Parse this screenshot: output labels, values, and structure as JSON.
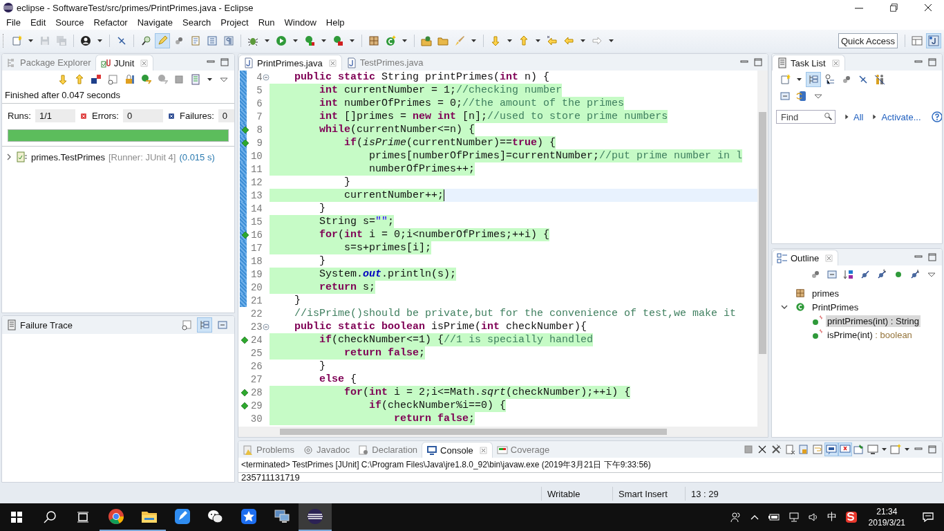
{
  "window": {
    "title": "eclipse - SoftwareTest/src/primes/PrintPrimes.java - Eclipse"
  },
  "menu": [
    "File",
    "Edit",
    "Source",
    "Refactor",
    "Navigate",
    "Search",
    "Project",
    "Run",
    "Window",
    "Help"
  ],
  "toolbar": {
    "highlight_pressed": true,
    "quick_access": {
      "placeholder": "Quick Access"
    }
  },
  "left_panel": {
    "tabs": [
      {
        "label": "Package Explorer",
        "selected": false
      },
      {
        "label": "JUnit",
        "selected": true
      }
    ],
    "status": "Finished after 0.047 seconds",
    "counters": [
      {
        "label": "Runs:",
        "value": "1/1"
      },
      {
        "label": "Errors:",
        "value": "0"
      },
      {
        "label": "Failures:",
        "value": "0"
      }
    ],
    "progress": {
      "level": 1
    },
    "tree": [
      {
        "label": "primes.TestPrimes",
        "detail": "[Runner: JUnit 4]",
        "time": "(0.015 s)",
        "expanded": false
      }
    ]
  },
  "failure_trace": {
    "title": "Failure Trace",
    "compare_pressed": true
  },
  "editor": {
    "tabs": [
      {
        "label": "PrintPrimes.java",
        "selected": true
      },
      {
        "label": "TestPrimes.java",
        "selected": false
      }
    ],
    "lines": [
      {
        "number": "4",
        "covered": false,
        "branch": false,
        "range": true,
        "fold": true,
        "current": false,
        "segments": [
          {
            "kind": "keyword",
            "text": "    public static"
          },
          {
            "kind": "plain",
            "text": " String printPrimes("
          },
          {
            "kind": "keyword",
            "text": "int"
          },
          {
            "kind": "plain",
            "text": " n) {"
          }
        ]
      },
      {
        "number": "5",
        "covered": true,
        "branch": false,
        "range": true,
        "fold": false,
        "current": false,
        "segments": [
          {
            "kind": "keyword",
            "text": "        int"
          },
          {
            "kind": "plain",
            "text": " currentNumber = 1;"
          },
          {
            "kind": "comment",
            "text": "//checking number"
          }
        ]
      },
      {
        "number": "6",
        "covered": true,
        "branch": false,
        "range": true,
        "fold": false,
        "current": false,
        "segments": [
          {
            "kind": "keyword",
            "text": "        int"
          },
          {
            "kind": "plain",
            "text": " numberOfPrimes = 0;"
          },
          {
            "kind": "comment",
            "text": "//the amount of the primes"
          }
        ]
      },
      {
        "number": "7",
        "covered": true,
        "branch": false,
        "range": true,
        "fold": false,
        "current": false,
        "segments": [
          {
            "kind": "keyword",
            "text": "        int"
          },
          {
            "kind": "plain",
            "text": " []primes = "
          },
          {
            "kind": "keyword",
            "text": "new int"
          },
          {
            "kind": "plain",
            "text": " [n];"
          },
          {
            "kind": "comment",
            "text": "//used to store prime numbers"
          }
        ]
      },
      {
        "number": "8",
        "covered": true,
        "branch": true,
        "range": true,
        "fold": false,
        "current": false,
        "segments": [
          {
            "kind": "keyword",
            "text": "        while"
          },
          {
            "kind": "plain",
            "text": "(currentNumber<=n) {"
          }
        ]
      },
      {
        "number": "9",
        "covered": true,
        "branch": true,
        "range": true,
        "fold": false,
        "current": false,
        "segments": [
          {
            "kind": "keyword",
            "text": "            if"
          },
          {
            "kind": "plain",
            "text": "("
          },
          {
            "kind": "method",
            "text": "isPrime"
          },
          {
            "kind": "plain",
            "text": "(currentNumber)=="
          },
          {
            "kind": "keyword",
            "text": "true"
          },
          {
            "kind": "plain",
            "text": ") {"
          }
        ]
      },
      {
        "number": "10",
        "covered": true,
        "branch": false,
        "range": true,
        "fold": false,
        "current": false,
        "segments": [
          {
            "kind": "plain",
            "text": "                primes[numberOfPrimes]=currentNumber;"
          },
          {
            "kind": "comment",
            "text": "//put prime number in l"
          }
        ]
      },
      {
        "number": "11",
        "covered": true,
        "branch": false,
        "range": true,
        "fold": false,
        "current": false,
        "segments": [
          {
            "kind": "plain",
            "text": "                numberOfPrimes++;"
          }
        ]
      },
      {
        "number": "12",
        "covered": false,
        "branch": false,
        "range": true,
        "fold": false,
        "current": false,
        "segments": [
          {
            "kind": "plain",
            "text": "            }"
          }
        ]
      },
      {
        "number": "13",
        "covered": true,
        "branch": false,
        "range": true,
        "fold": false,
        "current": true,
        "segments": [
          {
            "kind": "plain",
            "text": "            currentNumber++;"
          }
        ]
      },
      {
        "number": "14",
        "covered": false,
        "branch": false,
        "range": true,
        "fold": false,
        "current": false,
        "segments": [
          {
            "kind": "plain",
            "text": "        }"
          }
        ]
      },
      {
        "number": "15",
        "covered": true,
        "branch": false,
        "range": true,
        "fold": false,
        "current": false,
        "segments": [
          {
            "kind": "plain",
            "text": "        String s="
          },
          {
            "kind": "string",
            "text": "\"\""
          },
          {
            "kind": "plain",
            "text": ";"
          }
        ]
      },
      {
        "number": "16",
        "covered": true,
        "branch": true,
        "range": true,
        "fold": false,
        "current": false,
        "segments": [
          {
            "kind": "keyword",
            "text": "        for"
          },
          {
            "kind": "plain",
            "text": "("
          },
          {
            "kind": "keyword",
            "text": "int"
          },
          {
            "kind": "plain",
            "text": " i = 0;i<numberOfPrimes;++i) {"
          }
        ]
      },
      {
        "number": "17",
        "covered": true,
        "branch": false,
        "range": true,
        "fold": false,
        "current": false,
        "segments": [
          {
            "kind": "plain",
            "text": "            s=s+primes[i];"
          }
        ]
      },
      {
        "number": "18",
        "covered": false,
        "branch": false,
        "range": true,
        "fold": false,
        "current": false,
        "segments": [
          {
            "kind": "plain",
            "text": "        }"
          }
        ]
      },
      {
        "number": "19",
        "covered": true,
        "branch": false,
        "range": true,
        "fold": false,
        "current": false,
        "segments": [
          {
            "kind": "plain",
            "text": "        System."
          },
          {
            "kind": "field",
            "text": "out"
          },
          {
            "kind": "plain",
            "text": ".println(s);"
          }
        ]
      },
      {
        "number": "20",
        "covered": true,
        "branch": false,
        "range": true,
        "fold": false,
        "current": false,
        "segments": [
          {
            "kind": "keyword",
            "text": "        return"
          },
          {
            "kind": "plain",
            "text": " s;"
          }
        ]
      },
      {
        "number": "21",
        "covered": false,
        "branch": false,
        "range": true,
        "fold": false,
        "current": false,
        "segments": [
          {
            "kind": "plain",
            "text": "    }"
          }
        ]
      },
      {
        "number": "22",
        "covered": false,
        "branch": false,
        "range": false,
        "fold": false,
        "current": false,
        "segments": [
          {
            "kind": "comment",
            "text": "    //isPrime()should be private,but for the convenience of test,we make it"
          }
        ]
      },
      {
        "number": "23",
        "covered": false,
        "branch": false,
        "range": false,
        "fold": true,
        "current": false,
        "segments": [
          {
            "kind": "keyword",
            "text": "    public static boolean"
          },
          {
            "kind": "plain",
            "text": " isPrime("
          },
          {
            "kind": "keyword",
            "text": "int"
          },
          {
            "kind": "plain",
            "text": " checkNumber){"
          }
        ]
      },
      {
        "number": "24",
        "covered": true,
        "branch": true,
        "range": false,
        "fold": false,
        "current": false,
        "segments": [
          {
            "kind": "keyword",
            "text": "        if"
          },
          {
            "kind": "plain",
            "text": "(checkNumber<=1) {"
          },
          {
            "kind": "comment",
            "text": "//1 is specially handled"
          }
        ]
      },
      {
        "number": "25",
        "covered": true,
        "branch": false,
        "range": false,
        "fold": false,
        "current": false,
        "segments": [
          {
            "kind": "keyword",
            "text": "            return false"
          },
          {
            "kind": "plain",
            "text": ";"
          }
        ]
      },
      {
        "number": "26",
        "covered": false,
        "branch": false,
        "range": false,
        "fold": false,
        "current": false,
        "segments": [
          {
            "kind": "plain",
            "text": "        }"
          }
        ]
      },
      {
        "number": "27",
        "covered": false,
        "branch": false,
        "range": false,
        "fold": false,
        "current": false,
        "segments": [
          {
            "kind": "keyword",
            "text": "        else"
          },
          {
            "kind": "plain",
            "text": " {"
          }
        ]
      },
      {
        "number": "28",
        "covered": true,
        "branch": true,
        "range": false,
        "fold": false,
        "current": false,
        "segments": [
          {
            "kind": "keyword",
            "text": "            for"
          },
          {
            "kind": "plain",
            "text": "("
          },
          {
            "kind": "keyword",
            "text": "int"
          },
          {
            "kind": "plain",
            "text": " i = 2;i<=Math."
          },
          {
            "kind": "method",
            "text": "sqrt"
          },
          {
            "kind": "plain",
            "text": "(checkNumber);++i) {"
          }
        ]
      },
      {
        "number": "29",
        "covered": true,
        "branch": true,
        "range": false,
        "fold": false,
        "current": false,
        "segments": [
          {
            "kind": "keyword",
            "text": "                if"
          },
          {
            "kind": "plain",
            "text": "(checkNumber%i==0) {"
          }
        ]
      },
      {
        "number": "30",
        "covered": true,
        "branch": false,
        "range": false,
        "fold": false,
        "current": false,
        "segments": [
          {
            "kind": "keyword",
            "text": "                    return false"
          },
          {
            "kind": "plain",
            "text": ";"
          }
        ]
      }
    ]
  },
  "task_list": {
    "title": "Task List",
    "hierarchy_pressed": true,
    "find": {
      "placeholder": "Find"
    },
    "links": [
      "All",
      "Activate..."
    ]
  },
  "outline": {
    "title": "Outline",
    "tree": [
      {
        "label": "primes",
        "kind": "package",
        "selected": false,
        "expanded": false
      },
      {
        "label": "PrintPrimes",
        "kind": "class",
        "selected": false,
        "expanded": true,
        "children": [
          {
            "label": "printPrimes(int)",
            "type": " : String",
            "kind": "method",
            "selected": true
          },
          {
            "label": "isPrime(int)",
            "type": " : boolean",
            "kind": "method",
            "selected": false
          }
        ]
      }
    ]
  },
  "bottom": {
    "tabs": [
      {
        "label": "Problems",
        "selected": false
      },
      {
        "label": "Javadoc",
        "selected": false
      },
      {
        "label": "Declaration",
        "selected": false
      },
      {
        "label": "Console",
        "selected": true
      },
      {
        "label": "Coverage",
        "selected": false
      }
    ],
    "toggles_pressed": [
      true,
      true
    ],
    "header": "<terminated> TestPrimes [JUnit] C:\\Program Files\\Java\\jre1.8.0_92\\bin\\javaw.exe (2019年3月21日 下午9:33:56)",
    "output": "235711131719"
  },
  "status_bar": [
    "Writable",
    "Smart Insert",
    "13 : 29"
  ],
  "taskbar": {
    "apps": [
      {
        "running": true,
        "active": false
      },
      {
        "running": true,
        "active": false
      },
      {
        "running": false,
        "active": false
      },
      {
        "running": false,
        "active": false
      },
      {
        "running": false,
        "active": false
      },
      {
        "running": false,
        "active": false
      },
      {
        "running": true,
        "active": true
      }
    ],
    "ime": "中",
    "time": "21:34",
    "date": "2019/3/21"
  }
}
